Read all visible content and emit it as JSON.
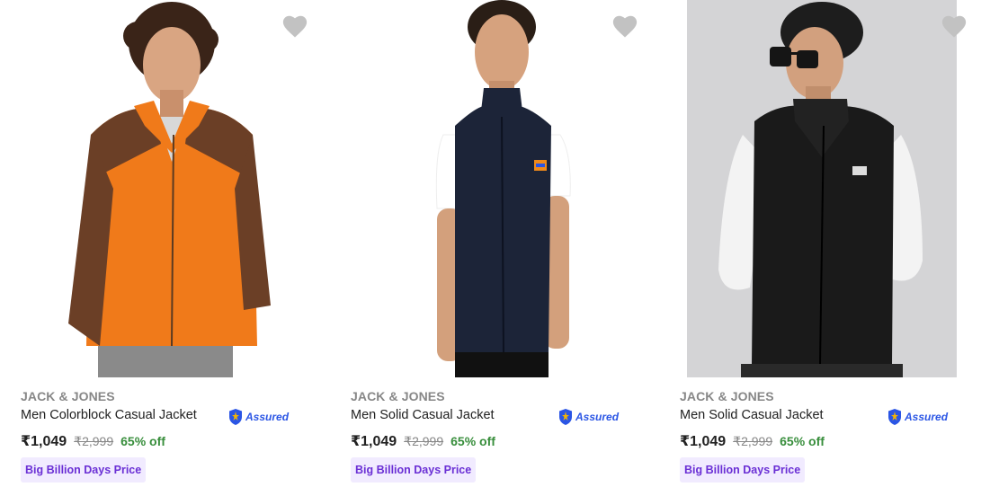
{
  "products": [
    {
      "brand": "JACK & JONES",
      "title": "Men Colorblock Casual Jacket",
      "assured": "Assured",
      "price": "₹1,049",
      "mrp": "₹2,999",
      "discount": "65% off",
      "badge": "Big Billion Days Price",
      "image_icon": "orange-brown-colorblock-fleece-jacket",
      "colors": {
        "primary": "#f07a1a",
        "secondary": "#6b3f26",
        "bg": "#ffffff"
      }
    },
    {
      "brand": "JACK & JONES",
      "title": "Men Solid Casual Jacket",
      "assured": "Assured",
      "price": "₹1,049",
      "mrp": "₹2,999",
      "discount": "65% off",
      "badge": "Big Billion Days Price",
      "image_icon": "navy-fleece-vest",
      "colors": {
        "primary": "#1c2438",
        "secondary": "#ffffff",
        "bg": "#ffffff"
      }
    },
    {
      "brand": "JACK & JONES",
      "title": "Men Solid Casual Jacket",
      "assured": "Assured",
      "price": "₹1,049",
      "mrp": "₹2,999",
      "discount": "65% off",
      "badge": "Big Billion Days Price",
      "image_icon": "black-fleece-vest",
      "colors": {
        "primary": "#1a1a1a",
        "secondary": "#ffffff",
        "bg": "#d4d4d6"
      }
    }
  ],
  "theme": {
    "wishlist_icon_color": "#c2c2c2",
    "assured_blue": "#2a55e5",
    "assured_gold": "#f5b400",
    "discount_green": "#388e3c",
    "badge_bg": "#f1ebff",
    "badge_text": "#6a2fd5"
  }
}
